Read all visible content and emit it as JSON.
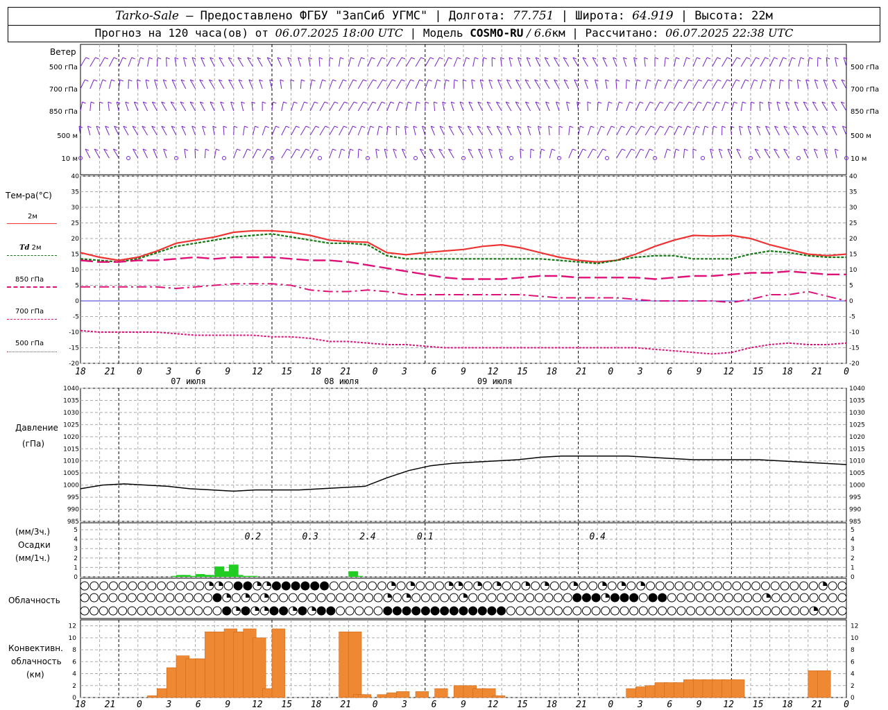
{
  "header": {
    "station": "Tarko-Sale",
    "provider": " – Предоставлено ФГБУ \"ЗапСиб УГМС\" | Долгота: ",
    "lon": "77.751",
    "lat_label": " | Широта: ",
    "lat": "64.919",
    "alt_label": " | Высота: 22м",
    "fc_label": "Прогноз на 120 часа(ов) от ",
    "fc_from": "06.07.2025 18:00 UTC",
    "model_label": "  | Модель ",
    "model": "COSMO-RU",
    "res": " / 6.6",
    "res_unit": "км",
    "calc_label": " | Рассчитано: ",
    "calc": "06.07.2025 22:38 UTC"
  },
  "colors": {
    "t2m": "#ee3333",
    "td2m": "#117711",
    "t850": "#dd1177",
    "t700": "#dd1177",
    "t500": "#dd1177",
    "wind": "#7722cc",
    "precip": "#22cc22",
    "conv": "#ee8833",
    "pressure": "#000000",
    "zero": "#3333cc"
  },
  "labels": {
    "wind": "Ветер",
    "wind_levels": [
      "500 гПа",
      "700 гПа",
      "850 гПа",
      "500 м",
      "10   м"
    ],
    "temp": "Тем-ра(°C)",
    "leg_2m": "2м",
    "leg_td": "Td",
    "leg_td_2m": "2м",
    "leg_850": "850 гПа",
    "leg_700": "700 гПа",
    "leg_500": "500 гПа",
    "pressure": "Давление",
    "pressure_unit": "(гПа)",
    "precip_unit1": "(мм/3ч.)",
    "precip": "Осадки",
    "precip_unit2": "(мм/1ч.)",
    "cloud": "Облачность",
    "conv1": "Конвективн.",
    "conv2": "облачность",
    "conv3": "(км)"
  },
  "chart_data": {
    "type": "line",
    "x_hours": [
      18,
      21,
      0,
      3,
      6,
      9,
      12,
      15,
      18,
      21,
      0,
      3,
      6,
      9,
      12,
      15,
      18,
      21,
      0,
      3,
      6,
      9,
      12,
      15,
      18,
      21,
      0
    ],
    "dates": [
      "07 июля",
      "08 июля",
      "09 июля"
    ],
    "temp_axis": {
      "ylim": [
        -20,
        40
      ],
      "ticks": [
        -20,
        -15,
        -10,
        -5,
        0,
        5,
        10,
        15,
        20,
        25,
        30,
        35,
        40
      ]
    },
    "pressure_axis": {
      "ylim": [
        985,
        1040
      ],
      "ticks": [
        985,
        990,
        995,
        1000,
        1005,
        1010,
        1015,
        1020,
        1025,
        1030,
        1035,
        1040
      ]
    },
    "precip_axis": {
      "ylim": [
        0,
        5
      ],
      "ticks": [
        0,
        1,
        2,
        3,
        4,
        5
      ]
    },
    "conv_axis": {
      "ylim": [
        0,
        13
      ],
      "ticks": [
        0,
        2,
        4,
        6,
        8,
        10,
        12
      ]
    },
    "series": [
      {
        "name": "2м",
        "values": [
          15.5,
          14,
          13,
          14,
          16,
          18.5,
          19.5,
          20.5,
          22,
          22.5,
          22.5,
          22,
          21,
          19.5,
          19,
          18.8,
          15.5,
          14.8,
          15.5,
          16,
          16.5,
          17.5,
          18,
          17,
          15.5,
          14,
          13,
          12.5,
          13,
          15,
          17.5,
          19.5,
          21,
          20.8,
          21,
          20,
          18,
          16.5,
          15,
          14.5,
          15
        ]
      },
      {
        "name": "Td 2м",
        "values": [
          13.5,
          13,
          12.5,
          13.5,
          15.5,
          17.5,
          18.5,
          19.5,
          20.5,
          21,
          21.5,
          20.5,
          19.5,
          18.5,
          18.5,
          18,
          14.5,
          13.5,
          13.5,
          13.5,
          13.5,
          13.5,
          13.5,
          13.5,
          13.5,
          13,
          12.5,
          12,
          13,
          14,
          14.5,
          14.5,
          13.5,
          13.5,
          13.5,
          15,
          16,
          15.5,
          14.5,
          14,
          14
        ]
      },
      {
        "name": "850 гПа",
        "values": [
          13,
          12.5,
          12.5,
          13,
          13,
          13.5,
          14,
          13.5,
          14,
          14,
          14,
          13.5,
          13,
          13,
          12.5,
          11.5,
          10.5,
          9.5,
          8.5,
          7.5,
          7,
          7,
          7,
          7.5,
          8,
          8,
          7.5,
          7.5,
          7.5,
          7.5,
          7,
          7.5,
          8,
          8,
          8.5,
          9,
          9,
          9.5,
          9,
          8.5,
          8.5
        ]
      },
      {
        "name": "700 гПа",
        "values": [
          4.5,
          4.5,
          4.5,
          4.5,
          4.5,
          4,
          4.5,
          5,
          5.5,
          5.5,
          5.5,
          5,
          3.5,
          3,
          3,
          3.5,
          3,
          2,
          2,
          2,
          2,
          2,
          2,
          2,
          1.5,
          1,
          1,
          1,
          1,
          0.5,
          0,
          0,
          0,
          0,
          -0.5,
          0.5,
          2,
          2,
          3,
          1.5,
          0
        ]
      },
      {
        "name": "500 гПа",
        "values": [
          -9.5,
          -10,
          -10,
          -10,
          -10,
          -10.5,
          -11,
          -11,
          -11,
          -11,
          -11.5,
          -11.5,
          -12,
          -13,
          -13,
          -13.5,
          -14,
          -14,
          -14.5,
          -15,
          -15,
          -15,
          -15,
          -15,
          -15,
          -15,
          -15,
          -15,
          -15,
          -15,
          -15.5,
          -16,
          -16.5,
          -17,
          -16.5,
          -15,
          -14,
          -13.5,
          -14,
          -14,
          -13.5
        ]
      },
      {
        "name": "Давление",
        "values": [
          998.5,
          1000,
          1000.5,
          1000,
          999.5,
          998.5,
          998,
          997.5,
          998,
          998,
          998,
          998.5,
          999,
          999.5,
          1003,
          1006,
          1008,
          1009,
          1009.5,
          1010,
          1010.5,
          1011.5,
          1012,
          1012,
          1012,
          1012,
          1011.5,
          1011,
          1010.5,
          1010.5,
          1010.5,
          1010.5,
          1010,
          1009.5,
          1009,
          1008.5
        ]
      }
    ],
    "precip_labels": [
      {
        "hour": 9,
        "text": "0.2"
      },
      {
        "hour": 12,
        "text": "0.3"
      },
      {
        "hour": 15,
        "text": "2.4"
      },
      {
        "hour": 18,
        "text": "0.1"
      },
      {
        "hour": 27,
        "text": "0.4"
      }
    ],
    "precip_bars": [
      [
        9.5,
        0.1
      ],
      [
        10,
        0.2
      ],
      [
        10.5,
        0.2
      ],
      [
        11,
        0.1
      ],
      [
        12,
        0.3
      ],
      [
        12.5,
        0.2
      ],
      [
        13,
        0.2
      ],
      [
        14,
        1.1
      ],
      [
        14.5,
        0.5
      ],
      [
        15,
        0.6
      ],
      [
        15.5,
        1.3
      ],
      [
        16,
        0.2
      ],
      [
        17,
        0.1
      ],
      [
        17.5,
        0.1
      ],
      [
        28,
        0.6
      ],
      [
        28.5,
        0.1
      ]
    ],
    "conv_bars": [
      [
        7,
        0.3
      ],
      [
        8,
        1.5
      ],
      [
        9,
        5
      ],
      [
        10,
        7
      ],
      [
        11,
        6.5
      ],
      [
        12,
        6.5
      ],
      [
        13,
        11
      ],
      [
        14,
        11
      ],
      [
        15,
        11.5
      ],
      [
        16,
        11
      ],
      [
        17,
        11.5
      ],
      [
        18,
        10
      ],
      [
        19,
        1.5
      ],
      [
        20,
        11.5
      ],
      [
        27,
        11
      ],
      [
        28,
        11
      ],
      [
        28.5,
        0.5
      ],
      [
        29,
        0.5
      ],
      [
        31,
        0.5
      ],
      [
        32,
        0.8
      ],
      [
        33,
        1
      ],
      [
        35,
        1
      ],
      [
        37,
        1.5
      ],
      [
        39,
        2
      ],
      [
        40,
        2
      ],
      [
        41,
        1.5
      ],
      [
        42,
        1.5
      ],
      [
        43,
        0.3
      ],
      [
        57,
        1.5
      ],
      [
        58,
        1.8
      ],
      [
        59,
        2
      ],
      [
        60,
        2.5
      ],
      [
        61,
        2.5
      ],
      [
        62,
        2.5
      ],
      [
        63,
        3
      ],
      [
        64,
        3
      ],
      [
        65,
        3
      ],
      [
        66,
        3
      ],
      [
        67,
        3
      ],
      [
        68,
        3
      ],
      [
        76,
        4.5
      ],
      [
        77,
        4.5
      ]
    ],
    "cloud_layers": [
      "OOOOOOOOOOOOOQQOHHQQHHHHHHOOOOOOQOQOOOQQOQOQOOQOQOOQOOQOQOQOOOOOOOOOOOOOOOOOOQOO",
      "OOOOOOOOOOOOOOHQOQOQOOOOOOOOOOOOQOQOOOOOQOOOOOOOOOOOHHHQHHHOHHOOOOOOOOOOQOOOOOOOO",
      "OOOOOOOOOOOOOOOHQHQQHHQHQHHOOOOOHHHHHHHHHHHHHOOOOOOOOOOOOOOOOOOOOOOOOOOOOOOOOQOOO"
    ]
  }
}
